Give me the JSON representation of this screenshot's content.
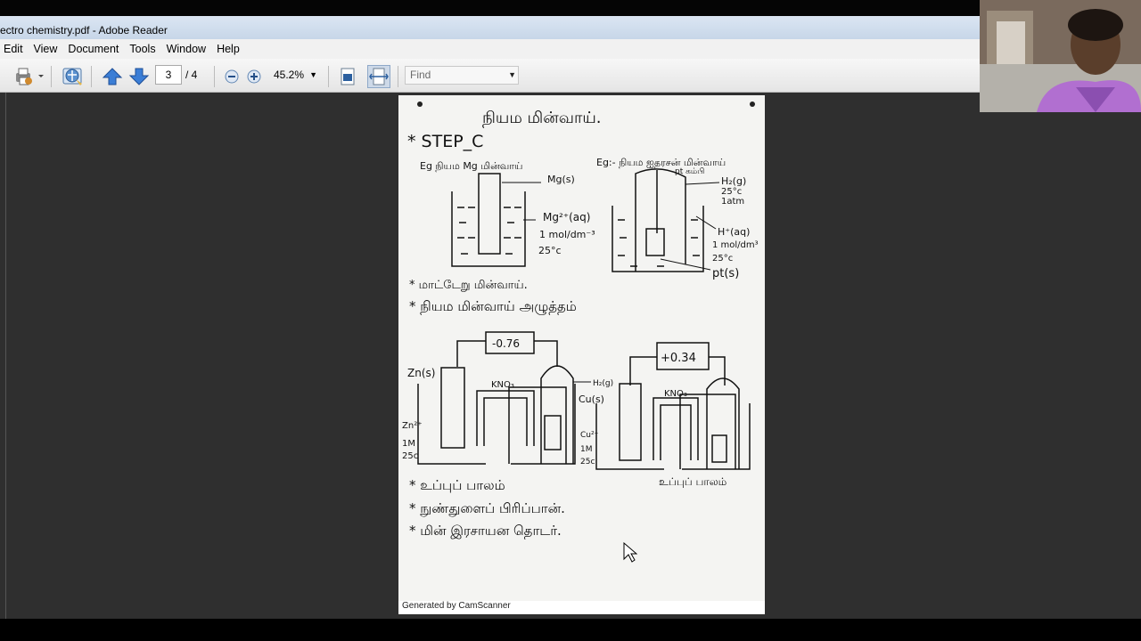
{
  "window": {
    "title": "ectro chemistry.pdf - Adobe Reader"
  },
  "menu": [
    "Edit",
    "View",
    "Document",
    "Tools",
    "Window",
    "Help"
  ],
  "toolbar": {
    "current_page": "3",
    "total_pages": "/ 4",
    "zoom": "45.2%",
    "find_placeholder": "Find"
  },
  "document": {
    "title": "நியம மின்வாய்.",
    "step": "* STEP_C",
    "eg_left": "Eg நியம Mg மின்வாய்",
    "eg_right": "Eg:- நியம ஐதரசன் மின்வாய்",
    "mg_labels": [
      "Mg(s)",
      "Mg²⁺(aq)",
      "1 mol/dm⁻³",
      "25°c"
    ],
    "h_labels": [
      "pt கம்பி",
      "H₂(g)",
      "25°c",
      "1atm",
      "H⁺(aq)",
      "1 mol/dm³",
      "25°c",
      "pt(s)"
    ],
    "bullets_1": [
      "* மாட்டேறு மின்வாய்.",
      "* நியம மின்வாய் அழுத்தம்"
    ],
    "cell_left": {
      "reading": "-0.76",
      "salt": "KNO₃",
      "electrode": "Zn(s)",
      "solution": [
        "Zn²⁺",
        "1M",
        "25c"
      ],
      "gas": "H₂(g)"
    },
    "cell_right": {
      "reading": "+0.34",
      "salt": "KNO₃",
      "electrode": "Cu(s)",
      "solution": [
        "Cu²⁺",
        "1M",
        "25c"
      ],
      "bridge_label": "உப்புப் பாலம்"
    },
    "bullets_2": [
      "* உப்புப் பாலம்",
      "* நுண்துளைப் பிரிப்பான்.",
      "* மின் இரசாயன தொடர்."
    ],
    "footer": "Generated by CamScanner"
  }
}
